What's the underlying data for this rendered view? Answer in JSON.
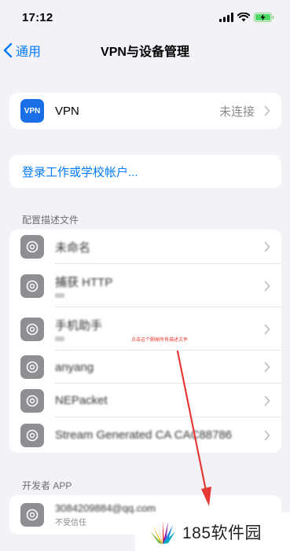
{
  "status_bar": {
    "time": "17:12"
  },
  "nav": {
    "back_label": "通用",
    "title": "VPN与设备管理"
  },
  "vpn": {
    "icon_text": "VPN",
    "label": "VPN",
    "status": "未连接"
  },
  "login": {
    "label": "登录工作或学校帐户..."
  },
  "profiles_section": {
    "header": "配置描述文件",
    "items": [
      {
        "label": "未命名"
      },
      {
        "label": "捕获 HTTP"
      },
      {
        "label": "手机助手"
      },
      {
        "label": "anyang"
      },
      {
        "label": "NEPacket"
      },
      {
        "label": "Stream Generated CA CAC88786"
      }
    ]
  },
  "annotation": {
    "text": "点击这个删掉所有描述文件"
  },
  "developer_section": {
    "header": "开发者 APP",
    "item": {
      "label": "3084209884@qq.com",
      "sublabel": "不受信任"
    }
  },
  "watermark": {
    "text": "185软件园"
  }
}
